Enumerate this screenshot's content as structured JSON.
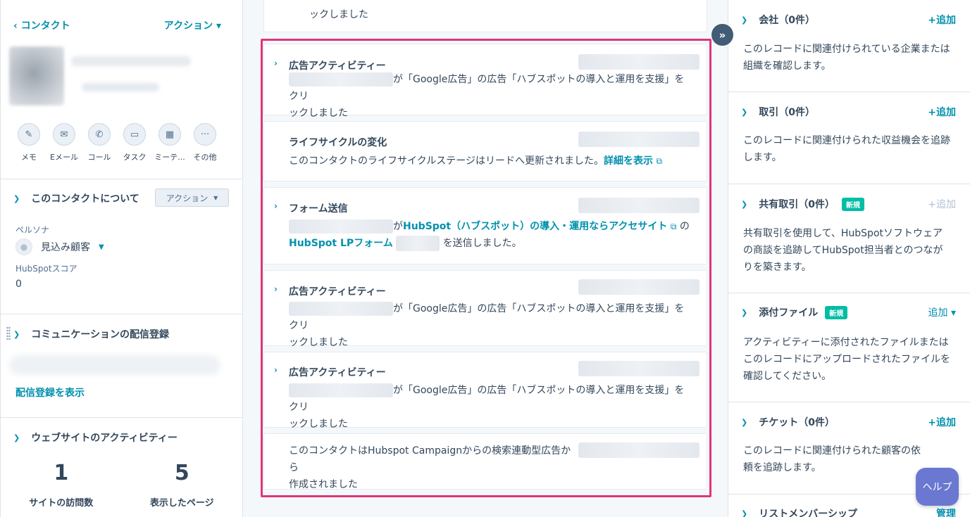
{
  "left": {
    "back_label": "‹ コンタクト",
    "actions_label": "アクション ▾",
    "quick_actions": [
      {
        "icon": "edit-icon",
        "glyph": "✎",
        "label": "メモ"
      },
      {
        "icon": "email-icon",
        "glyph": "✉",
        "label": "Eメール"
      },
      {
        "icon": "phone-icon",
        "glyph": "✆",
        "label": "コール"
      },
      {
        "icon": "task-icon",
        "glyph": "▭",
        "label": "タスク"
      },
      {
        "icon": "calendar-icon",
        "glyph": "▦",
        "label": "ミーテ..."
      },
      {
        "icon": "more-icon",
        "glyph": "···",
        "label": "その他"
      }
    ],
    "about": {
      "title": "このコンタクトについて",
      "action_button": "アクション",
      "persona_label": "ペルソナ",
      "persona_value": "見込み顧客",
      "score_label": "HubSpotスコア",
      "score_value": "0"
    },
    "communication": {
      "title": "コミュニケーションの配信登録",
      "link": "配信登録を表示"
    },
    "website": {
      "title": "ウェブサイトのアクティビティー",
      "visits_value": "1",
      "visits_label": "サイトの訪問数",
      "pages_value": "5",
      "pages_label": "表示したページ"
    }
  },
  "timeline": {
    "top_card_text": "ックしました",
    "cards": [
      {
        "title": "広告アクティビティー",
        "line1_suffix": "が「Google広告」の広告「ハブスポットの導入と運用を支援」をクリ",
        "line2": "ックしました"
      },
      {
        "title": "ライフサイクルの変化",
        "body": "このコンタクトのライフサイクルステージはリードへ更新されました。",
        "link": "詳細を表示"
      },
      {
        "title": "フォーム送信",
        "mid_text": "が",
        "site_link": "HubSpot（ハブスポット）の導入・運用ならアクセサイト",
        "of_text": "の",
        "form_link": "HubSpot LPフォーム",
        "sent_text": "を送信しました。"
      },
      {
        "title": "広告アクティビティー",
        "line1_suffix": "が「Google広告」の広告「ハブスポットの導入と運用を支援」をクリ",
        "line2": "ックしました"
      },
      {
        "title": "広告アクティビティー",
        "line1_suffix": "が「Google広告」の広告「ハブスポットの導入と運用を支援」をクリ",
        "line2": "ックしました"
      },
      {
        "line1": "このコンタクトはHubspot Campaignからの検索連動型広告から",
        "line2": "作成されました"
      }
    ]
  },
  "right": {
    "sections": [
      {
        "title": "会社（0件）",
        "add": "+追加",
        "body": "このレコードに関連付けられている企業または組織を確認します。"
      },
      {
        "title": "取引（0件）",
        "add": "+追加",
        "body": "このレコードに関連付けられた収益機会を追跡します。"
      },
      {
        "title": "共有取引（0件）",
        "badge": "新規",
        "add": "+追加",
        "body": "共有取引を使用して、HubSpotソフトウェアの商談を追跡してHubSpot担当者とのつながりを築きます。"
      },
      {
        "title": "添付ファイル",
        "badge": "新規",
        "add": "追加 ▾",
        "body": "アクティビティーに添付されたファイルまたはこのレコードにアップロードされたファイルを確認してください。"
      },
      {
        "title": "チケット（0件）",
        "add": "+追加",
        "body": "このレコードに関連付けられた顧客の依頼を追跡します。"
      },
      {
        "title": "リストメンバーシップ",
        "add": "管理"
      }
    ],
    "help_label": "ヘルプ"
  }
}
